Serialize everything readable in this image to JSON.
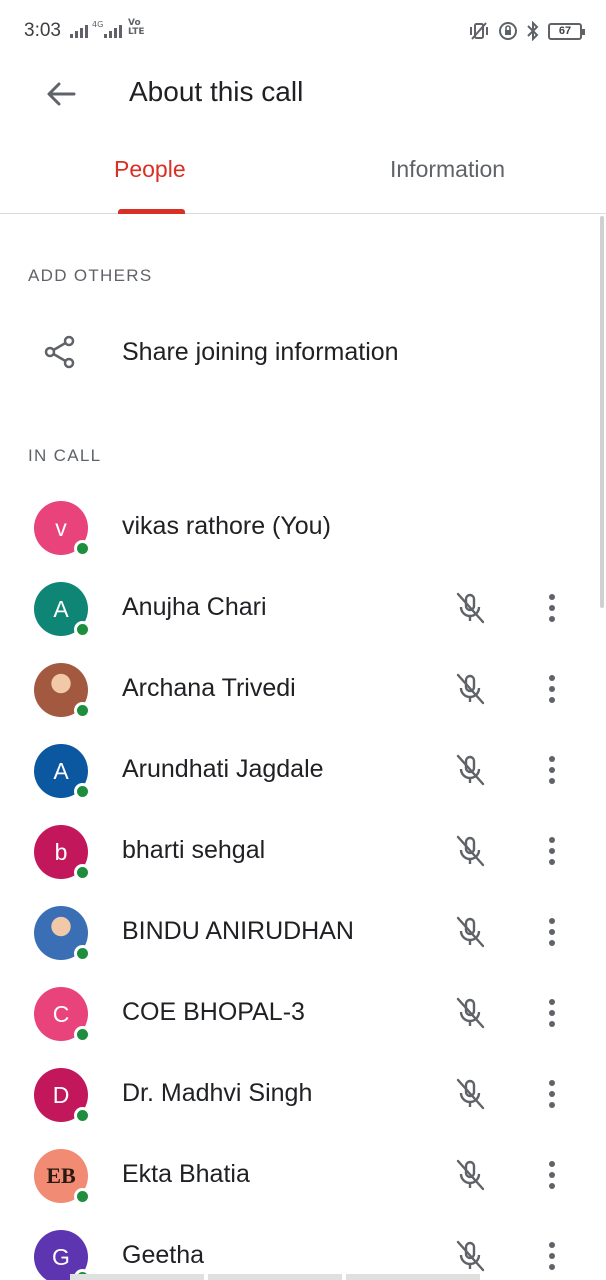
{
  "status_bar": {
    "time": "3:03",
    "network_label": "4G",
    "volte_label": "Vo LTE",
    "battery": "67"
  },
  "app_bar": {
    "title": "About this call",
    "back_icon": "arrow-back-icon"
  },
  "tabs": [
    {
      "label": "People",
      "selected": true
    },
    {
      "label": "Information",
      "selected": false
    }
  ],
  "add_others": {
    "heading": "ADD OTHERS",
    "share_label": "Share joining information",
    "share_icon": "share-icon"
  },
  "in_call": {
    "heading": "IN CALL",
    "participants": [
      {
        "name": "vikas rathore (You)",
        "initial": "v",
        "color": "#e8437a",
        "photo": false,
        "muted_controls": false
      },
      {
        "name": "Anujha Chari",
        "initial": "A",
        "color": "#0f8575",
        "photo": false,
        "muted_controls": true
      },
      {
        "name": "Archana Trivedi",
        "initial": "",
        "color": "#a3593f",
        "photo": true,
        "muted_controls": true
      },
      {
        "name": "Arundhati Jagdale",
        "initial": "A",
        "color": "#0b57a0",
        "photo": false,
        "muted_controls": true
      },
      {
        "name": "bharti sehgal",
        "initial": "b",
        "color": "#c2185b",
        "photo": false,
        "muted_controls": true
      },
      {
        "name": "BINDU ANIRUDHAN",
        "initial": "",
        "color": "#3a6fb5",
        "photo": true,
        "muted_controls": true
      },
      {
        "name": "COE BHOPAL-3",
        "initial": "C",
        "color": "#e8437a",
        "photo": false,
        "muted_controls": true
      },
      {
        "name": "Dr. Madhvi Singh",
        "initial": "D",
        "color": "#c2185b",
        "photo": false,
        "muted_controls": true
      },
      {
        "name": "Ekta Bhatia",
        "initial": "EB",
        "color": "#f28b74",
        "photo": true,
        "muted_controls": true
      },
      {
        "name": "Geetha",
        "initial": "G",
        "color": "#5e35b1",
        "photo": false,
        "muted_controls": true
      }
    ]
  },
  "colors": {
    "accent": "#d93025",
    "presence": "#1e8e3e"
  }
}
